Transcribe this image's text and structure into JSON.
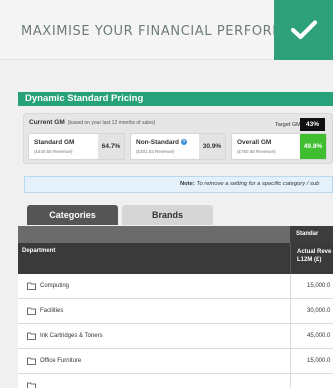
{
  "banner": {
    "title": "MAXIMISE YOUR FINANCIAL PERFORMANCE",
    "icon": "checkmark-icon",
    "color": "#2ea07a"
  },
  "pricing": {
    "title": "Dynamic Standard Pricing",
    "current_gm_label": "Current GM",
    "current_gm_note": "(based on your last 12 months of sales)",
    "target_gm_label": "Target GM",
    "target_gm_value": "43%",
    "cards": [
      {
        "name": "Standard GM",
        "sub": "(£440.55 Revenue)",
        "value": "64.7%",
        "value_bg": "#e3e3e3",
        "value_color": "#333333"
      },
      {
        "name": "Non-Standard",
        "sub": "(£301.03 Revenue)",
        "value": "30.9%",
        "value_bg": "#e3e3e3",
        "value_color": "#333333",
        "info_icon": "info-icon"
      },
      {
        "name": "Overall GM",
        "sub": "(£750.58 Revenue)",
        "value": "49.8%",
        "value_bg": "#3fbf2f",
        "value_color": "#ffffff"
      }
    ]
  },
  "note": {
    "label": "Note:",
    "text": "To remove a setting for a specific category / sub"
  },
  "tabs": [
    {
      "label": "Categories",
      "active": true
    },
    {
      "label": "Brands",
      "active": false
    }
  ],
  "table": {
    "group_header": "Standar",
    "columns": {
      "department": "Department",
      "revenue_line1": "Actual Reve",
      "revenue_line2": "L12M (£)"
    },
    "rows": [
      {
        "name": "Computing",
        "value": "15,000.0"
      },
      {
        "name": "Facilities",
        "value": "30,000.0"
      },
      {
        "name": "Ink Cartridges & Toners",
        "value": "45,000.0"
      },
      {
        "name": "Office Furniture",
        "value": "15,000.0"
      },
      {
        "name": "",
        "value": ""
      }
    ]
  }
}
